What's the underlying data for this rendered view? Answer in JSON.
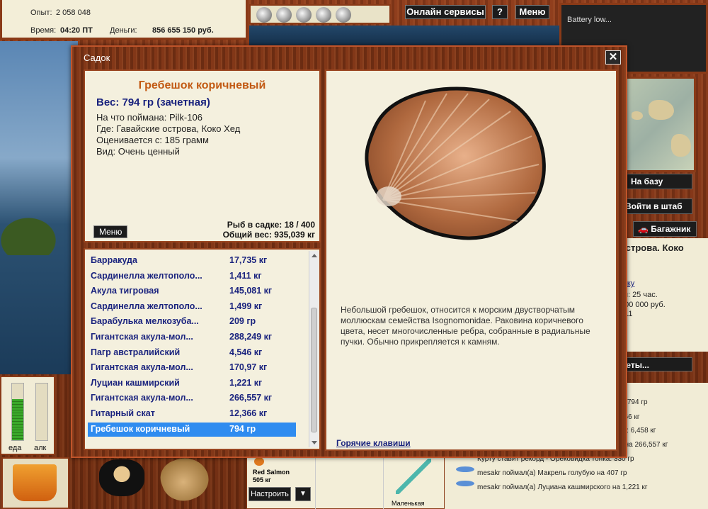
{
  "status": {
    "exp_label": "Опыт:",
    "exp_value": "2 058 048",
    "time_label": "Время:",
    "time_value": "04:20 ПТ",
    "money_label": "Деньги:",
    "money_value": "856 655 150 руб."
  },
  "topbar": {
    "online_label": "Онлайн сервисы",
    "help_label": "?",
    "menu_label": "Меню"
  },
  "battery_text": "Battery low...",
  "right_panel": {
    "base_label": "На базу",
    "hq_label": "Войти в штаб",
    "trunk_label": "🚗 Багажник",
    "location_partial": "острова. Коко",
    "link_partial": "вку",
    "line1": "ки: 25 час.",
    "line2": "500 000 руб.",
    "line3": ": 11",
    "secrets_label": "реты..."
  },
  "feed": {
    "lines": [
      "на 794 гр",
      "366 кг",
      "ль: 6,458 кг",
      "л на 266,557 кг",
      "Курту ставит рекорд - Орековидка тонка: 330 гр",
      "mesakr поймал(а) Макрель голубую на 407 гр",
      "mesakr поймал(а) Луциана кашмирского на 1,221 кг"
    ]
  },
  "meters": {
    "food_label": "еда",
    "alc_label": "алк",
    "food_level": 0.72,
    "alc_level": 0.0
  },
  "lower": {
    "fish_name": "Red Salmon",
    "fish_weight": "505 кг",
    "setup_label": "Настроить",
    "tackle_label": "Маленькая"
  },
  "modal": {
    "title": "Садок",
    "close_label": "✕",
    "fish_title": "Гребешок коричневый",
    "weight": "Вес: 794 гр (зачетная)",
    "caught_on": "На что поймана: Pilk-106",
    "location": "Где: Гавайские острова, Коко Хед",
    "valued_from": "Оценивается с: 185 грамм",
    "kind": "Вид: Очень ценный",
    "menu_label": "Меню",
    "fish_count": "Рыб в садке: 18 / 400",
    "total_weight": "Общий вес: 935,039 кг",
    "description": "Небольшой гребешок, относится к морским двустворчатым моллюскам семейства Isognomonidae. Раковина коричневого цвета, несет многочисленные ребра, собранные в радиальные пучки. Обычно прикрепляется к камням.",
    "hotkeys_label": "Горячие клавиши",
    "catches": [
      {
        "name": "Барракуда",
        "weight": "17,735 кг"
      },
      {
        "name": "Сардинелла желтополо...",
        "weight": "1,411 кг"
      },
      {
        "name": "Акула тигровая",
        "weight": "145,081 кг"
      },
      {
        "name": "Сардинелла желтополо...",
        "weight": "1,499 кг"
      },
      {
        "name": "Барабулька мелкозуба...",
        "weight": "209 гр"
      },
      {
        "name": "Гигантская акула-мол...",
        "weight": "288,249 кг"
      },
      {
        "name": "Пагр австралийский",
        "weight": "4,546 кг"
      },
      {
        "name": "Гигантская акула-мол...",
        "weight": "170,97 кг"
      },
      {
        "name": "Луциан кашмирский",
        "weight": "1,221 кг"
      },
      {
        "name": "Гигантская акула-мол...",
        "weight": "266,557 кг"
      },
      {
        "name": "Гитарный скат",
        "weight": "12,366 кг"
      },
      {
        "name": "Гребешок коричневый",
        "weight": "794 гр"
      }
    ],
    "selected_index": 11
  },
  "colors": {
    "wood": "#7a3214",
    "panel": "#f4f0de",
    "fish_title": "#c25a14",
    "list_text": "#1a237e",
    "selection": "#2f8cf0"
  }
}
